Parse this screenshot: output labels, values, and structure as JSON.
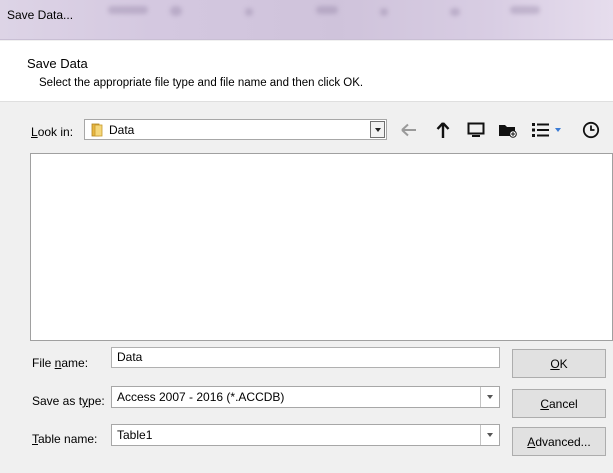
{
  "window": {
    "title": "Save Data..."
  },
  "header": {
    "title": "Save Data",
    "subtitle": "Select the appropriate file type and file name and then click OK."
  },
  "lookin": {
    "label_pre": "",
    "label_key": "L",
    "label_post": "ook in:",
    "value": "Data"
  },
  "toolbar": {
    "icons": [
      "back-arrow-icon",
      "up-arrow-icon",
      "desktop-icon",
      "new-folder-icon",
      "view-menu-icon",
      "recent-places-icon"
    ]
  },
  "fields": {
    "file_name": {
      "label_pre": "File ",
      "label_key": "n",
      "label_post": "ame:",
      "value": "Data"
    },
    "save_as_type": {
      "label_pre": "Save as t",
      "label_key": "y",
      "label_post": "pe:",
      "value": "Access 2007 - 2016 (*.ACCDB)"
    },
    "table_name": {
      "label_pre": "",
      "label_key": "T",
      "label_post": "able name:",
      "value": "Table1"
    }
  },
  "buttons": {
    "ok": {
      "pre": "",
      "key": "O",
      "post": "K"
    },
    "cancel": {
      "pre": "",
      "key": "C",
      "post": "ancel"
    },
    "advanced": {
      "pre": "",
      "key": "A",
      "post": "dvanced..."
    }
  }
}
